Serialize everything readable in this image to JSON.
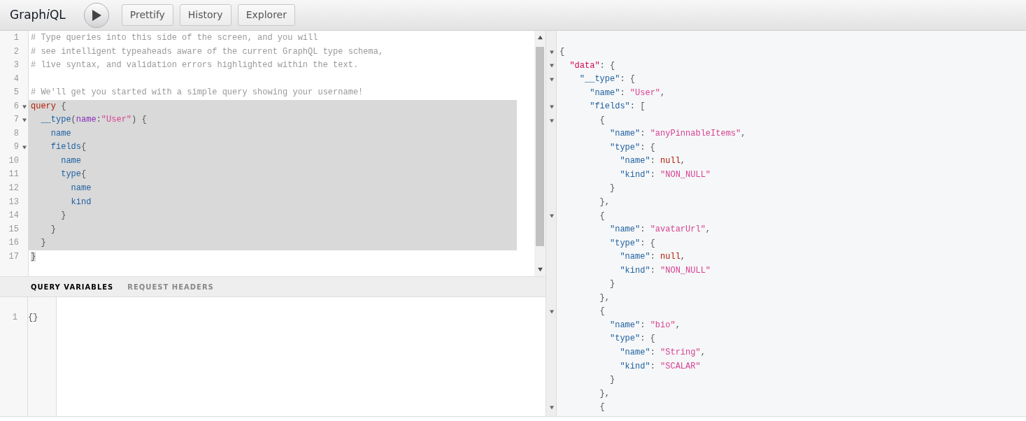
{
  "toolbar": {
    "title": "Graph",
    "title_italic": "i",
    "title_end": "QL",
    "buttons": [
      "Prettify",
      "History",
      "Explorer"
    ]
  },
  "query_editor": {
    "lines": [
      {
        "number": "1",
        "foldable": false,
        "selected": false,
        "tokens": [
          {
            "kind": "comment",
            "text": "# Type queries into this side of the screen, and you will"
          }
        ]
      },
      {
        "number": "2",
        "foldable": false,
        "selected": false,
        "tokens": [
          {
            "kind": "comment",
            "text": "# see intelligent typeaheads aware of the current GraphQL type schema,"
          }
        ]
      },
      {
        "number": "3",
        "foldable": false,
        "selected": false,
        "tokens": [
          {
            "kind": "comment",
            "text": "# live syntax, and validation errors highlighted within the text."
          }
        ]
      },
      {
        "number": "4",
        "foldable": false,
        "selected": false
      },
      {
        "number": "5",
        "foldable": false,
        "selected": false,
        "tokens": [
          {
            "kind": "comment",
            "text": "# We'll get you started with a simple query showing your username!"
          }
        ]
      },
      {
        "number": "6",
        "foldable": true,
        "selected": true,
        "tokens": [
          {
            "kind": "keyword",
            "text": "query"
          },
          {
            "kind": "punctuation",
            "text": " {"
          }
        ]
      },
      {
        "number": "7",
        "foldable": true,
        "selected": true,
        "tokens": [
          {
            "kind": "property",
            "text": "  __type"
          },
          {
            "kind": "punctuation",
            "text": "("
          },
          {
            "kind": "attribute",
            "text": "name"
          },
          {
            "kind": "punctuation",
            "text": ":"
          },
          {
            "kind": "string",
            "text": "\"User\""
          },
          {
            "kind": "punctuation",
            "text": ") {"
          }
        ]
      },
      {
        "number": "8",
        "foldable": false,
        "selected": true,
        "tokens": [
          {
            "kind": "property",
            "text": "    name"
          }
        ]
      },
      {
        "number": "9",
        "foldable": true,
        "selected": true,
        "tokens": [
          {
            "kind": "property",
            "text": "    fields"
          },
          {
            "kind": "punctuation",
            "text": "{"
          }
        ]
      },
      {
        "number": "10",
        "foldable": false,
        "selected": true,
        "tokens": [
          {
            "kind": "property",
            "text": "      name"
          }
        ]
      },
      {
        "number": "11",
        "foldable": false,
        "selected": true,
        "tokens": [
          {
            "kind": "property",
            "text": "      type"
          },
          {
            "kind": "punctuation",
            "text": "{"
          }
        ]
      },
      {
        "number": "12",
        "foldable": false,
        "selected": true,
        "tokens": [
          {
            "kind": "property",
            "text": "        name"
          }
        ]
      },
      {
        "number": "13",
        "foldable": false,
        "selected": true,
        "tokens": [
          {
            "kind": "property",
            "text": "        kind"
          }
        ]
      },
      {
        "number": "14",
        "foldable": false,
        "selected": true,
        "tokens": [
          {
            "kind": "punctuation",
            "text": "      }"
          }
        ]
      },
      {
        "number": "15",
        "foldable": false,
        "selected": true,
        "tokens": [
          {
            "kind": "punctuation",
            "text": "    }"
          }
        ]
      },
      {
        "number": "16",
        "foldable": false,
        "selected": true,
        "tokens": [
          {
            "kind": "punctuation",
            "text": "  }"
          }
        ]
      },
      {
        "number": "17",
        "foldable": false,
        "selected": true,
        "tokens": [
          {
            "kind": "punctuation",
            "text": "}"
          }
        ]
      }
    ]
  },
  "variables_tabs": [
    {
      "label": "QUERY VARIABLES",
      "selected": true
    },
    {
      "label": "REQUEST HEADERS",
      "selected": false
    }
  ],
  "variables_editor": {
    "lines": [
      {
        "number": "1",
        "tokens": [
          {
            "kind": "punctuation",
            "text": "{}"
          }
        ]
      }
    ]
  },
  "result": {
    "lines": [
      {
        "foldable": true,
        "tokens": [
          {
            "kind": "punctuation",
            "text": "{"
          }
        ]
      },
      {
        "foldable": true,
        "tokens": [
          {
            "kind": "def",
            "text": "  \"data\""
          },
          {
            "kind": "punctuation",
            "text": ": {"
          }
        ]
      },
      {
        "foldable": true,
        "tokens": [
          {
            "kind": "property",
            "text": "    \"__type\""
          },
          {
            "kind": "punctuation",
            "text": ": {"
          }
        ]
      },
      {
        "foldable": false,
        "tokens": [
          {
            "kind": "property",
            "text": "      \"name\""
          },
          {
            "kind": "punctuation",
            "text": ": "
          },
          {
            "kind": "string",
            "text": "\"User\""
          },
          {
            "kind": "punctuation",
            "text": ","
          }
        ]
      },
      {
        "foldable": true,
        "tokens": [
          {
            "kind": "property",
            "text": "      \"fields\""
          },
          {
            "kind": "punctuation",
            "text": ": ["
          }
        ]
      },
      {
        "foldable": true,
        "tokens": [
          {
            "kind": "punctuation",
            "text": "        {"
          }
        ]
      },
      {
        "foldable": false,
        "tokens": [
          {
            "kind": "property",
            "text": "          \"name\""
          },
          {
            "kind": "punctuation",
            "text": ": "
          },
          {
            "kind": "string",
            "text": "\"anyPinnableItems\""
          },
          {
            "kind": "punctuation",
            "text": ","
          }
        ]
      },
      {
        "foldable": false,
        "tokens": [
          {
            "kind": "property",
            "text": "          \"type\""
          },
          {
            "kind": "punctuation",
            "text": ": {"
          }
        ]
      },
      {
        "foldable": false,
        "tokens": [
          {
            "kind": "property",
            "text": "            \"name\""
          },
          {
            "kind": "punctuation",
            "text": ": "
          },
          {
            "kind": "null",
            "text": "null"
          },
          {
            "kind": "punctuation",
            "text": ","
          }
        ]
      },
      {
        "foldable": false,
        "tokens": [
          {
            "kind": "property",
            "text": "            \"kind\""
          },
          {
            "kind": "punctuation",
            "text": ": "
          },
          {
            "kind": "string",
            "text": "\"NON_NULL\""
          }
        ]
      },
      {
        "foldable": false,
        "tokens": [
          {
            "kind": "punctuation",
            "text": "          }"
          }
        ]
      },
      {
        "foldable": false,
        "tokens": [
          {
            "kind": "punctuation",
            "text": "        },"
          }
        ]
      },
      {
        "foldable": true,
        "tokens": [
          {
            "kind": "punctuation",
            "text": "        {"
          }
        ]
      },
      {
        "foldable": false,
        "tokens": [
          {
            "kind": "property",
            "text": "          \"name\""
          },
          {
            "kind": "punctuation",
            "text": ": "
          },
          {
            "kind": "string",
            "text": "\"avatarUrl\""
          },
          {
            "kind": "punctuation",
            "text": ","
          }
        ]
      },
      {
        "foldable": false,
        "tokens": [
          {
            "kind": "property",
            "text": "          \"type\""
          },
          {
            "kind": "punctuation",
            "text": ": {"
          }
        ]
      },
      {
        "foldable": false,
        "tokens": [
          {
            "kind": "property",
            "text": "            \"name\""
          },
          {
            "kind": "punctuation",
            "text": ": "
          },
          {
            "kind": "null",
            "text": "null"
          },
          {
            "kind": "punctuation",
            "text": ","
          }
        ]
      },
      {
        "foldable": false,
        "tokens": [
          {
            "kind": "property",
            "text": "            \"kind\""
          },
          {
            "kind": "punctuation",
            "text": ": "
          },
          {
            "kind": "string",
            "text": "\"NON_NULL\""
          }
        ]
      },
      {
        "foldable": false,
        "tokens": [
          {
            "kind": "punctuation",
            "text": "          }"
          }
        ]
      },
      {
        "foldable": false,
        "tokens": [
          {
            "kind": "punctuation",
            "text": "        },"
          }
        ]
      },
      {
        "foldable": true,
        "tokens": [
          {
            "kind": "punctuation",
            "text": "        {"
          }
        ]
      },
      {
        "foldable": false,
        "tokens": [
          {
            "kind": "property",
            "text": "          \"name\""
          },
          {
            "kind": "punctuation",
            "text": ": "
          },
          {
            "kind": "string",
            "text": "\"bio\""
          },
          {
            "kind": "punctuation",
            "text": ","
          }
        ]
      },
      {
        "foldable": false,
        "tokens": [
          {
            "kind": "property",
            "text": "          \"type\""
          },
          {
            "kind": "punctuation",
            "text": ": {"
          }
        ]
      },
      {
        "foldable": false,
        "tokens": [
          {
            "kind": "property",
            "text": "            \"name\""
          },
          {
            "kind": "punctuation",
            "text": ": "
          },
          {
            "kind": "string",
            "text": "\"String\""
          },
          {
            "kind": "punctuation",
            "text": ","
          }
        ]
      },
      {
        "foldable": false,
        "tokens": [
          {
            "kind": "property",
            "text": "            \"kind\""
          },
          {
            "kind": "punctuation",
            "text": ": "
          },
          {
            "kind": "string",
            "text": "\"SCALAR\""
          }
        ]
      },
      {
        "foldable": false,
        "tokens": [
          {
            "kind": "punctuation",
            "text": "          }"
          }
        ]
      },
      {
        "foldable": false,
        "tokens": [
          {
            "kind": "punctuation",
            "text": "        },"
          }
        ]
      },
      {
        "foldable": true,
        "tokens": [
          {
            "kind": "punctuation",
            "text": "        {"
          }
        ]
      }
    ]
  }
}
